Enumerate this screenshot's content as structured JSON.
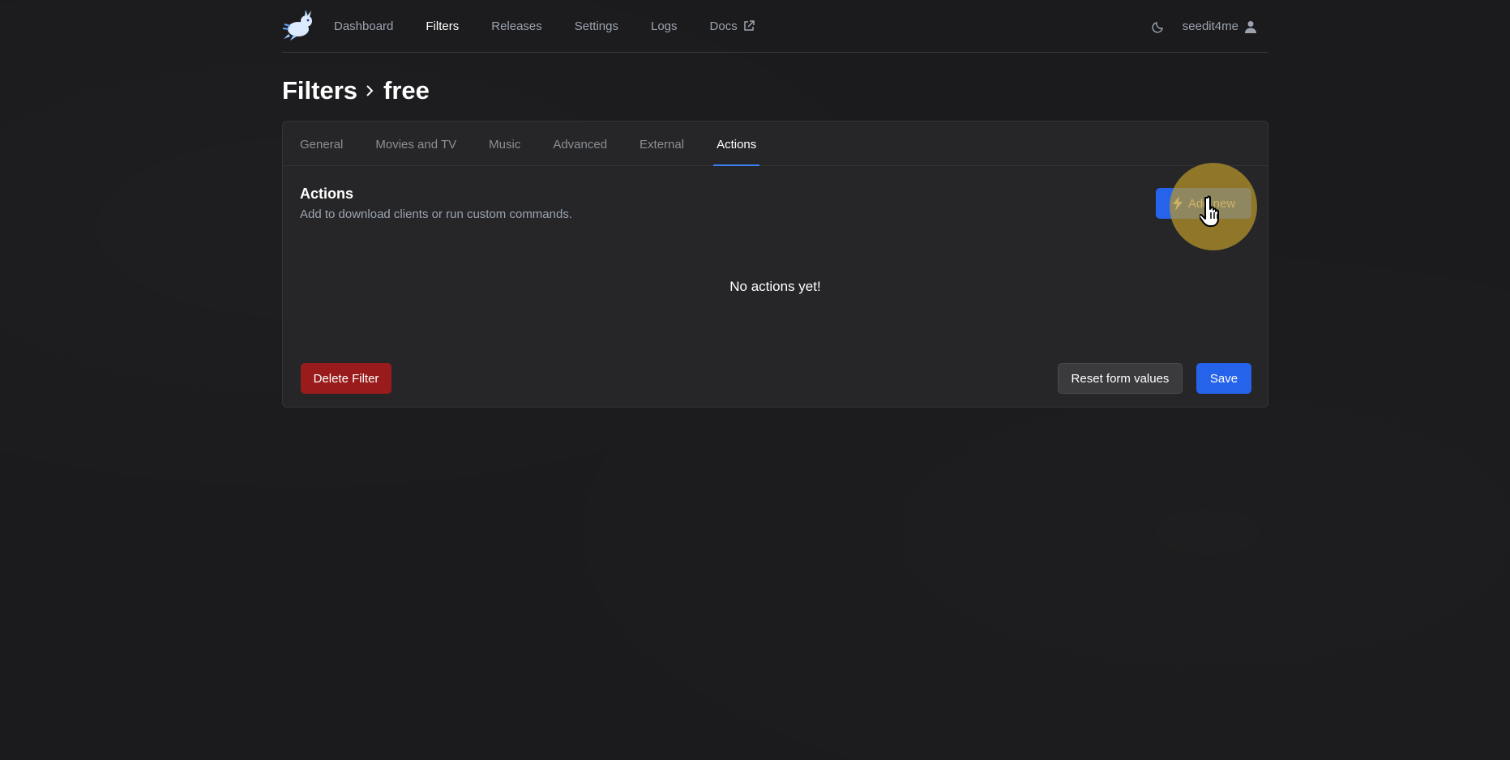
{
  "nav": {
    "links": [
      {
        "label": "Dashboard"
      },
      {
        "label": "Filters",
        "active": true
      },
      {
        "label": "Releases"
      },
      {
        "label": "Settings"
      },
      {
        "label": "Logs"
      },
      {
        "label": "Docs",
        "external": true
      }
    ],
    "user": "seedit4me"
  },
  "breadcrumb": {
    "root": "Filters",
    "current": "free"
  },
  "tabs": [
    {
      "label": "General"
    },
    {
      "label": "Movies and TV"
    },
    {
      "label": "Music"
    },
    {
      "label": "Advanced"
    },
    {
      "label": "External"
    },
    {
      "label": "Actions",
      "active": true
    }
  ],
  "actions": {
    "title": "Actions",
    "description": "Add to download clients or run custom commands.",
    "add_label": "Add new",
    "empty_text": "No actions yet!"
  },
  "footer": {
    "delete_label": "Delete Filter",
    "reset_label": "Reset form values",
    "save_label": "Save"
  },
  "colors": {
    "accent": "#2563eb",
    "danger": "#991b1b",
    "background": "#1b1b1d",
    "card": "#262628"
  }
}
